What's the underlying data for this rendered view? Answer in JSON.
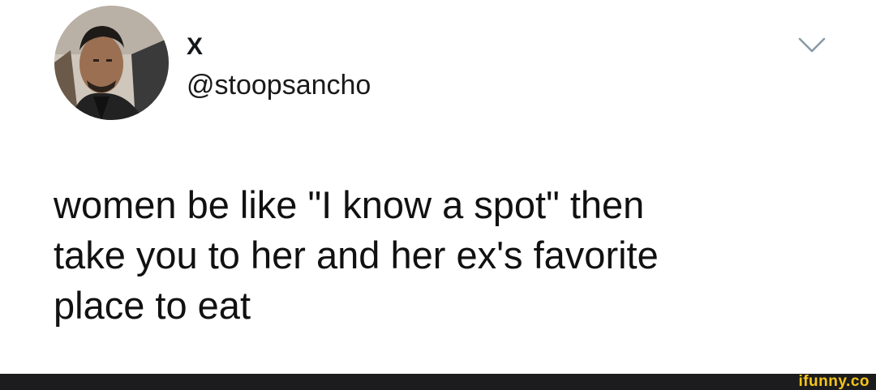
{
  "tweet": {
    "display_name": "X",
    "handle": "@stoopsancho",
    "text": "women be like \"I know a spot\" then\ntake you to her and her ex's favorite\nplace to eat",
    "avatar_icon": "profile-photo",
    "menu_icon": "chevron-down-icon"
  },
  "footer": {
    "watermark": "ifunny.co"
  },
  "colors": {
    "text": "#111111",
    "watermark": "#f5c518",
    "footer_background": "#1c1c1e",
    "caret": "#8899a6"
  }
}
